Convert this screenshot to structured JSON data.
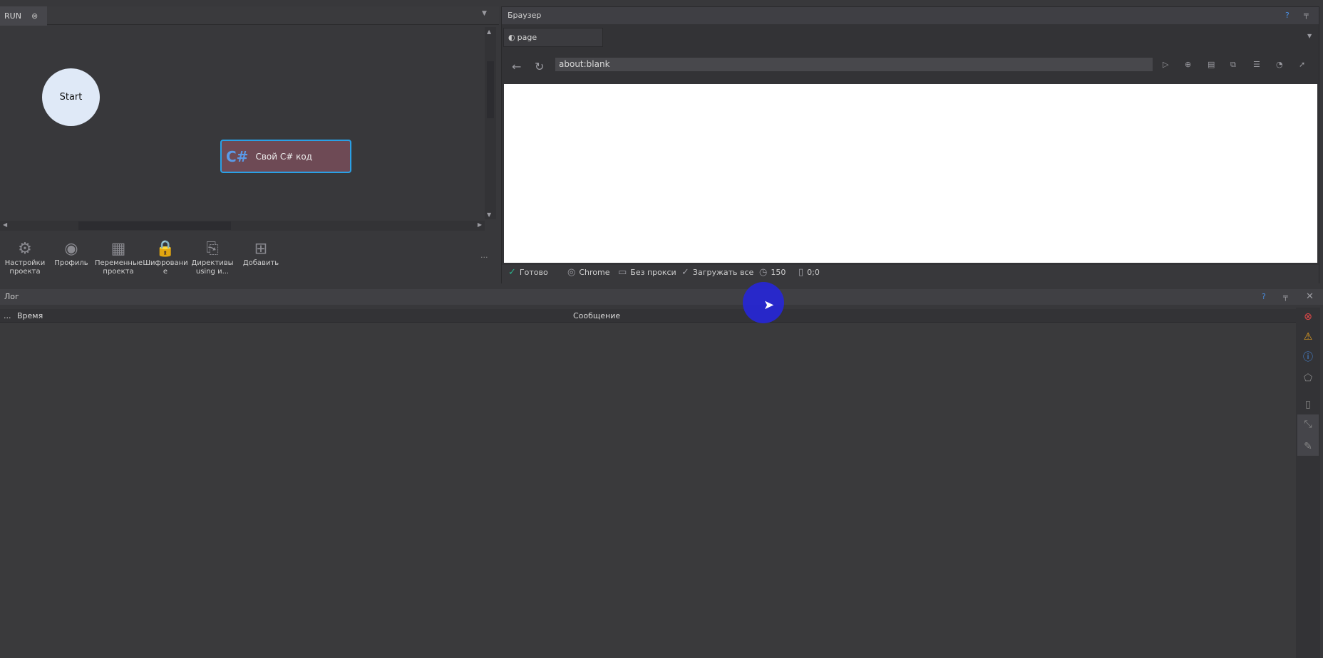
{
  "left_panel": {
    "tab": "RUN",
    "nodes": {
      "start": "Start",
      "csharp_icon": "C#",
      "csharp": "Свой C# код"
    },
    "toolbar": [
      {
        "icon": "gear-icon",
        "glyph": "⚙",
        "label": "Настройки проекта"
      },
      {
        "icon": "profile-icon",
        "glyph": "◉",
        "label": "Профиль"
      },
      {
        "icon": "grid-icon",
        "glyph": "▦",
        "label": "Переменные проекта"
      },
      {
        "icon": "lock-icon",
        "glyph": "🔒",
        "label": "Шифровани е"
      },
      {
        "icon": "code-file-icon",
        "glyph": "⎘",
        "label": "Директивы using и..."
      },
      {
        "icon": "add-icon",
        "glyph": "⊞",
        "label": "Добавить"
      }
    ],
    "more": "..."
  },
  "browser": {
    "title": "Браузер",
    "help": "?",
    "tab": "page",
    "url": "about:blank",
    "status": {
      "ready": "Готово",
      "engine": "Chrome",
      "proxy": "Без прокси",
      "load": "Загружать все",
      "timeout": "150",
      "coords": "0;0"
    }
  },
  "log": {
    "title": "Лог",
    "help": "?",
    "columns": {
      "dots": "...",
      "time": "Время",
      "message": "Сообщение"
    }
  },
  "colors": {
    "accent": "#2aa0e6",
    "node_fill": "#6e4a55",
    "start_fill": "#dfe9f7",
    "cursor_highlight": "#2626d9"
  }
}
